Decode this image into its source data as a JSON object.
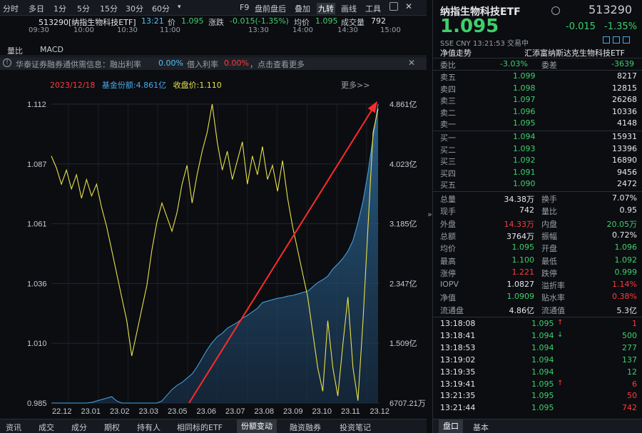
{
  "toolbar": {
    "periods": [
      "分时",
      "多日",
      "1分",
      "5分",
      "15分",
      "30分",
      "60分",
      "▾"
    ],
    "right_buttons": [
      "F9",
      "盘前盘后",
      "叠加",
      "九转",
      "画线",
      "工具"
    ],
    "active_right": "九转"
  },
  "info": {
    "name": "513290[纳指生物科技ETF]",
    "time": "13:21",
    "price_label": "价",
    "price": "1.095",
    "change_label": "涨跌",
    "change": "-0.015(-1.35%)",
    "avg_label": "均价",
    "avg": "1.095",
    "volume_label": "成交量",
    "volume": "792"
  },
  "time_axis": [
    "09:30",
    "10:00",
    "10:30",
    "11:00",
    "13:30",
    "14:00",
    "14:30",
    "15:00"
  ],
  "tabs": [
    "量比",
    "MACD"
  ],
  "notice": {
    "text1": "华泰证券融券通供需信息：融出利率",
    "rate1": "0.00%",
    "text2": "借入利率",
    "rate2": "0.00%",
    "text3": "，点击查看更多"
  },
  "chart_legend": {
    "date": "2023/12/18",
    "fund_share": "基金份额:4.861亿",
    "close": "收盘价:1.110",
    "more": "更多>>"
  },
  "chart_data": {
    "type": "line",
    "x_ticks": [
      "22.12",
      "23.01",
      "23.02",
      "23.03",
      "23.05",
      "23.06",
      "23.07",
      "23.08",
      "23.09",
      "23.10",
      "23.11",
      "23.12"
    ],
    "left_axis_ticks": [
      "1.112",
      "1.087",
      "1.061",
      "1.036",
      "1.010",
      "0.985"
    ],
    "right_axis_ticks": [
      "4.861亿",
      "4.023亿",
      "3.185亿",
      "2.347亿",
      "1.509亿",
      "6707.21万"
    ],
    "series": [
      {
        "name": "收盘价",
        "color": "#e8e04a",
        "values": [
          1.09,
          1.085,
          1.078,
          1.084,
          1.076,
          1.082,
          1.072,
          1.08,
          1.073,
          1.078,
          1.068,
          1.06,
          1.05,
          1.04,
          1.03,
          1.02,
          1.005,
          1.015,
          1.025,
          1.035,
          1.05,
          1.062,
          1.07,
          1.064,
          1.058,
          1.066,
          1.078,
          1.086,
          1.07,
          1.082,
          1.092,
          1.1,
          1.112,
          1.096,
          1.084,
          1.092,
          1.08,
          1.088,
          1.096,
          1.078,
          1.09,
          1.082,
          1.094,
          1.08,
          1.086,
          1.075,
          1.088,
          1.072,
          1.06,
          1.05,
          1.04,
          1.03,
          1.015,
          1.0,
          0.99,
          1.02,
          1.0,
          0.988,
          1.01,
          1.03,
          1.0,
          0.986,
          1.02,
          1.06,
          1.1,
          1.11
        ]
      },
      {
        "name": "基金份额",
        "color": "#4aa8e8",
        "unit": "亿",
        "values": [
          0.67,
          0.66,
          0.66,
          0.65,
          0.65,
          0.66,
          0.66,
          0.67,
          0.68,
          0.7,
          0.72,
          0.74,
          0.76,
          0.7,
          0.66,
          0.65,
          0.64,
          0.63,
          0.62,
          0.62,
          0.63,
          0.65,
          0.7,
          0.78,
          0.86,
          0.92,
          0.96,
          1.02,
          1.08,
          1.18,
          1.3,
          1.42,
          1.52,
          1.6,
          1.65,
          1.72,
          1.76,
          1.8,
          1.86,
          1.9,
          1.95,
          2.0,
          2.08,
          2.1,
          2.12,
          2.14,
          2.15,
          2.17,
          2.18,
          2.2,
          2.22,
          2.24,
          2.3,
          2.36,
          2.4,
          2.45,
          2.55,
          2.62,
          2.7,
          2.8,
          2.95,
          3.2,
          3.5,
          3.9,
          4.4,
          4.861
        ]
      }
    ],
    "ylim_left": [
      0.985,
      1.112
    ],
    "ylim_right": [
      0.6707,
      4.861
    ],
    "annotation": "red arrow rising from 23.05 low to 23.12 high",
    "grid": true
  },
  "bottom_tabs": [
    "资讯",
    "成交",
    "成分",
    "期权",
    "持有人",
    "相同标的ETF",
    "份额变动",
    "融资融券",
    "投资笔记"
  ],
  "active_bottom_tab": "份额变动",
  "quote": {
    "name": "纳指生物科技ETF",
    "code": "513290",
    "price": "1.095",
    "change": "-0.015",
    "change_pct": "-1.35%",
    "meta": "SSE  CNY  13:21:53  交易中",
    "trend_label": "净值走势",
    "fund_name": "汇添富纳斯达克生物科技ETF",
    "weibi_label": "委比",
    "weibi": "-3.03%",
    "weicha_label": "委差",
    "weicha": "-3639",
    "asks": [
      {
        "label": "卖五",
        "price": "1.099",
        "vol": "8217"
      },
      {
        "label": "卖四",
        "price": "1.098",
        "vol": "12815"
      },
      {
        "label": "卖三",
        "price": "1.097",
        "vol": "26268"
      },
      {
        "label": "卖二",
        "price": "1.096",
        "vol": "10336"
      },
      {
        "label": "卖一",
        "price": "1.095",
        "vol": "4148"
      }
    ],
    "bids": [
      {
        "label": "买一",
        "price": "1.094",
        "vol": "15931"
      },
      {
        "label": "买二",
        "price": "1.093",
        "vol": "13396"
      },
      {
        "label": "买三",
        "price": "1.092",
        "vol": "16890"
      },
      {
        "label": "买四",
        "price": "1.091",
        "vol": "9456"
      },
      {
        "label": "买五",
        "price": "1.090",
        "vol": "2472"
      }
    ],
    "stats": [
      {
        "l1": "总量",
        "v1": "34.38万",
        "c1": "white",
        "l2": "换手",
        "v2": "7.07%",
        "c2": "white"
      },
      {
        "l1": "现手",
        "v1": "742",
        "c1": "white",
        "l2": "量比",
        "v2": "0.95",
        "c2": "white"
      },
      {
        "l1": "外盘",
        "v1": "14.33万",
        "c1": "red",
        "l2": "内盘",
        "v2": "20.05万",
        "c2": "green"
      },
      {
        "l1": "总额",
        "v1": "3764万",
        "c1": "white",
        "l2": "振幅",
        "v2": "0.72%",
        "c2": "white"
      },
      {
        "l1": "均价",
        "v1": "1.095",
        "c1": "green",
        "l2": "开盘",
        "v2": "1.096",
        "c2": "green"
      },
      {
        "l1": "最高",
        "v1": "1.100",
        "c1": "green",
        "l2": "最低",
        "v2": "1.092",
        "c2": "green"
      },
      {
        "l1": "涨停",
        "v1": "1.221",
        "c1": "red",
        "l2": "跌停",
        "v2": "0.999",
        "c2": "green"
      },
      {
        "l1": "IOPV",
        "v1": "1.0827",
        "c1": "white",
        "l2": "溢折率",
        "v2": "1.14%",
        "c2": "red"
      },
      {
        "l1": "净值",
        "v1": "1.0909",
        "c1": "green",
        "l2": "贴水率",
        "v2": "0.38%",
        "c2": "red"
      },
      {
        "l1": "流通盘",
        "v1": "4.86亿",
        "c1": "white",
        "l2": "流通值",
        "v2": "5.3亿",
        "c2": "white"
      }
    ],
    "trades": [
      {
        "time": "13:18:08",
        "price": "1.095",
        "dir": "up",
        "vol": "1",
        "vcolor": "red"
      },
      {
        "time": "13:18:41",
        "price": "1.094",
        "dir": "down",
        "vol": "500",
        "vcolor": "green"
      },
      {
        "time": "13:18:53",
        "price": "1.094",
        "dir": "",
        "vol": "277",
        "vcolor": "green"
      },
      {
        "time": "13:19:02",
        "price": "1.094",
        "dir": "",
        "vol": "137",
        "vcolor": "green"
      },
      {
        "time": "13:19:35",
        "price": "1.094",
        "dir": "",
        "vol": "12",
        "vcolor": "green"
      },
      {
        "time": "13:19:41",
        "price": "1.095",
        "dir": "up",
        "vol": "6",
        "vcolor": "red"
      },
      {
        "time": "13:21:35",
        "price": "1.095",
        "dir": "",
        "vol": "50",
        "vcolor": "red"
      },
      {
        "time": "13:21:44",
        "price": "1.095",
        "dir": "",
        "vol": "742",
        "vcolor": "red"
      }
    ],
    "bottom_tabs": [
      "盘口",
      "基本"
    ],
    "active_bottom": "盘口"
  }
}
